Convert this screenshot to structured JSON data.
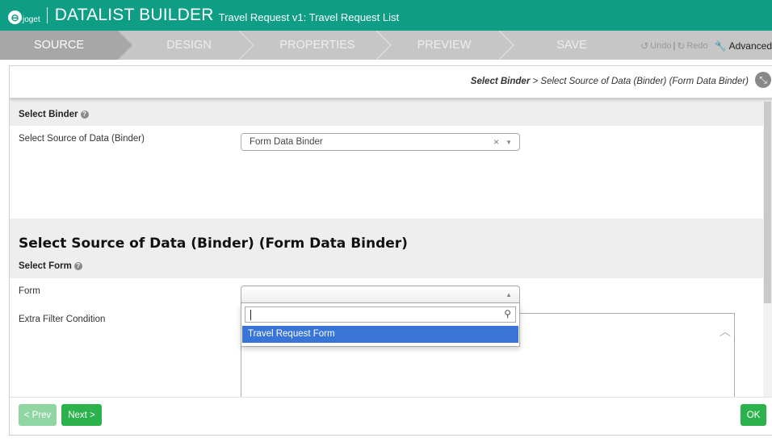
{
  "header": {
    "logo_text": "joget",
    "app_title": "DATALIST BUILDER",
    "subtitle": "Travel Request v1: Travel Request List"
  },
  "wizard": {
    "steps": [
      "SOURCE",
      "DESIGN",
      "PROPERTIES",
      "PREVIEW",
      "SAVE"
    ],
    "active": "SOURCE",
    "undo_label": "Undo",
    "redo_label": "Redo",
    "separator": "|",
    "advanced_label": "Advanced"
  },
  "breadcrumb": {
    "current": "Select Binder",
    "separator": ">",
    "next": "Select Source of Data (Binder) (Form Data Binder)"
  },
  "binder_section": {
    "title": "Select Binder",
    "field_label": "Select Source of Data (Binder)",
    "selected_value": "Form Data Binder",
    "clear_symbol": "×"
  },
  "source_section": {
    "title": "Select Source of Data (Binder) (Form Data Binder)",
    "subtitle": "Select Form",
    "form_label": "Form",
    "form_search_value": "",
    "form_options": [
      "Travel Request Form"
    ],
    "filter_label": "Extra Filter Condition"
  },
  "footer": {
    "prev_label": "< Prev",
    "next_label": "Next >",
    "ok_label": "OK"
  },
  "colors": {
    "brand": "#0d9e85",
    "button_green": "#2bb24c",
    "button_disabled": "#8fd6a2",
    "option_highlight": "#3875d7"
  }
}
